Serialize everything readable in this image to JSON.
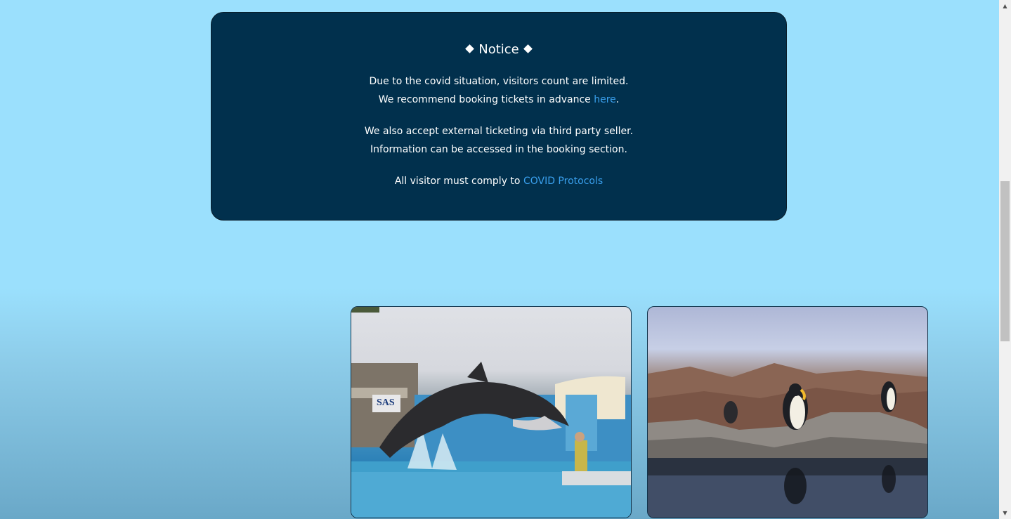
{
  "notice": {
    "title": "Notice",
    "line1": "Due to the covid situation, visitors count are limited.",
    "line2_prefix": "We recommend booking tickets in advance ",
    "line2_link": "here",
    "line2_suffix": ".",
    "line3": "We also accept external ticketing via third party seller.",
    "line4": "Information can be accessed in the booking section.",
    "line5_prefix": "All visitor must comply to ",
    "line5_link": "COVID Protocols"
  },
  "photos": {
    "photo1": "dolphin-show-photo",
    "photo2": "penguin-exhibit-photo"
  },
  "colors": {
    "background": "#9be0fd",
    "notice_bg": "#01304d",
    "link": "#3aa0ee"
  }
}
